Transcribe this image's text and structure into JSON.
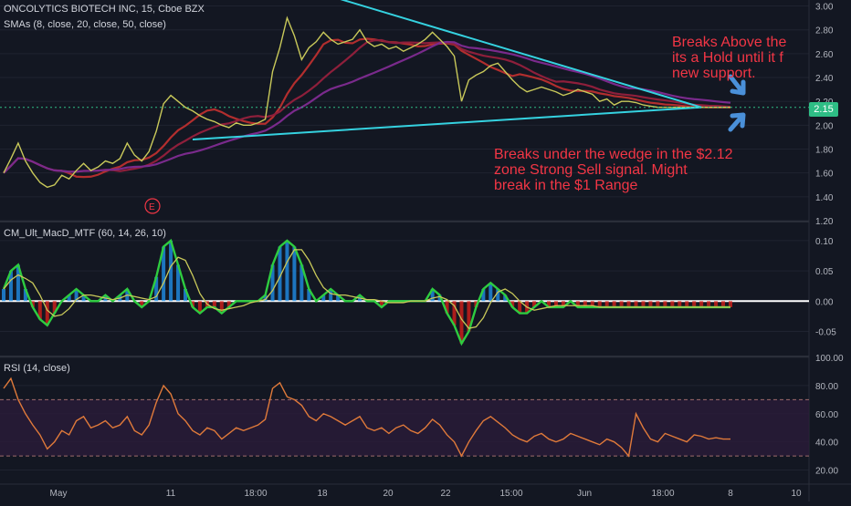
{
  "title": "ONCOLYTICS BIOTECH INC, 15, Cboe BZX",
  "price_pane": {
    "indicator_label": "SMAs (8, close, 20, close, 50, close)",
    "current_price": "2.15",
    "event_marker": "E",
    "annotation_upper": "Breaks Above the\nits a Hold until it f\nnew support.",
    "annotation_lower": "Breaks under the wedge in the $2.12\nzone Strong Sell signal. Might\nbreak in the $1 Range",
    "colors": {
      "price": "#c9c95a",
      "sma_fast": "#b22e2e",
      "sma_mid": "#8e1f3b",
      "sma_slow": "#7a2a8c",
      "wedge": "#35d2e0",
      "annotation": "#f23645",
      "arrow": "#4a90d9"
    }
  },
  "macd_pane": {
    "label": "CM_Ult_MacD_MTF (60, 14, 26, 10)",
    "colors": {
      "macd_up": "#2ecc40",
      "macd_down": "#e0201a",
      "signal": "#c9c95a",
      "hist_up": "#2196f3",
      "hist_down": "#e0201a"
    }
  },
  "rsi_pane": {
    "label": "RSI (14, close)",
    "colors": {
      "rsi": "#e07a3a",
      "band": "#2a1c3a",
      "bounds": "#9e6b6b"
    }
  },
  "x_axis_labels": [
    "May",
    "11",
    "18:00",
    "18",
    "20",
    "22",
    "15:00",
    "Jun",
    "18:00",
    "8",
    "10"
  ],
  "chart_data": [
    {
      "type": "line",
      "title": "ONCOLYTICS BIOTECH INC, 15, Cboe BZX",
      "y_ticks": [
        "3.00",
        "2.80",
        "2.60",
        "2.40",
        "2.20",
        "2.00",
        "1.80",
        "1.60",
        "1.40",
        "1.20"
      ],
      "ylim": [
        1.2,
        3.05
      ],
      "x": [
        0,
        2,
        4,
        6,
        8,
        10,
        12,
        14,
        16,
        18,
        20,
        22,
        24,
        26,
        28,
        30,
        32,
        34,
        36,
        38,
        40,
        42,
        44,
        46,
        48,
        50,
        52,
        54,
        56,
        58,
        60,
        62,
        64,
        66,
        68,
        70,
        72,
        74,
        76,
        78,
        80,
        82,
        84,
        86,
        88,
        90,
        92,
        94,
        96,
        98,
        100,
        102,
        104,
        106,
        108,
        110,
        112,
        114,
        116,
        118,
        120,
        122,
        124,
        126,
        128,
        130,
        132,
        134,
        136,
        138,
        140,
        142,
        144,
        146,
        148,
        150,
        152,
        154,
        156,
        158,
        160,
        162,
        164,
        166,
        168,
        170,
        172,
        174,
        176,
        178,
        180,
        182,
        184,
        186,
        188,
        190,
        192,
        194,
        196,
        198,
        200
      ],
      "series": [
        {
          "values": [
            1.6,
            1.72,
            1.85,
            1.7,
            1.6,
            1.52,
            1.48,
            1.5,
            1.58,
            1.55,
            1.62,
            1.68,
            1.62,
            1.65,
            1.7,
            1.68,
            1.72,
            1.85,
            1.75,
            1.7,
            1.78,
            1.95,
            2.18,
            2.25,
            2.2,
            2.15,
            2.12,
            2.08,
            2.05,
            2.03,
            2.0,
            1.98,
            2.02,
            2.0,
            2.0,
            2.02,
            2.05,
            2.45,
            2.65,
            2.9,
            2.75,
            2.55,
            2.65,
            2.7,
            2.78,
            2.72,
            2.68,
            2.7,
            2.72,
            2.8,
            2.7,
            2.66,
            2.68,
            2.64,
            2.66,
            2.62,
            2.65,
            2.68,
            2.72,
            2.78,
            2.72,
            2.66,
            2.58,
            2.2,
            2.38,
            2.42,
            2.45,
            2.5,
            2.52,
            2.45,
            2.38,
            2.32,
            2.28,
            2.3,
            2.32,
            2.3,
            2.28,
            2.25,
            2.27,
            2.3,
            2.28,
            2.26,
            2.2,
            2.22,
            2.17,
            2.2,
            2.2,
            2.19,
            2.17,
            2.16,
            2.15,
            2.15,
            2.15,
            2.15,
            2.15,
            2.15,
            2.15,
            2.15,
            2.15,
            2.15,
            2.15
          ]
        }
      ],
      "lines": [
        {
          "name": "wedge-upper",
          "x": [
            88,
            192
          ],
          "y": [
            3.1,
            2.15
          ]
        },
        {
          "name": "wedge-lower",
          "x": [
            52,
            192
          ],
          "y": [
            1.88,
            2.15
          ]
        }
      ]
    },
    {
      "type": "line",
      "title": "CM_Ult_MacD_MTF (60, 14, 26, 10)",
      "y_ticks": [
        "0.10",
        "0.05",
        "0.00",
        "-0.05"
      ],
      "ylim": [
        -0.09,
        0.13
      ],
      "x": [
        0,
        2,
        4,
        6,
        8,
        10,
        12,
        14,
        16,
        18,
        20,
        22,
        24,
        26,
        28,
        30,
        32,
        34,
        36,
        38,
        40,
        42,
        44,
        46,
        48,
        50,
        52,
        54,
        56,
        58,
        60,
        62,
        64,
        66,
        68,
        70,
        72,
        74,
        76,
        78,
        80,
        82,
        84,
        86,
        88,
        90,
        92,
        94,
        96,
        98,
        100,
        102,
        104,
        106,
        108,
        110,
        112,
        114,
        116,
        118,
        120,
        122,
        124,
        126,
        128,
        130,
        132,
        134,
        136,
        138,
        140,
        142,
        144,
        146,
        148,
        150,
        152,
        154,
        156,
        158,
        160,
        162,
        164,
        166,
        168,
        170,
        172,
        174,
        176,
        178,
        180,
        182,
        184,
        186,
        188,
        190,
        192,
        194,
        196,
        198,
        200
      ],
      "series": [
        {
          "name": "MACD",
          "values": [
            0.02,
            0.05,
            0.06,
            0.02,
            -0.01,
            -0.03,
            -0.04,
            -0.02,
            0.0,
            0.01,
            0.02,
            0.01,
            0.0,
            0.0,
            0.01,
            0.0,
            0.01,
            0.02,
            0.0,
            -0.01,
            0.0,
            0.04,
            0.09,
            0.1,
            0.06,
            0.02,
            -0.01,
            -0.02,
            -0.01,
            -0.01,
            -0.02,
            -0.01,
            0.0,
            0.0,
            0.0,
            0.0,
            0.01,
            0.06,
            0.09,
            0.1,
            0.09,
            0.06,
            0.02,
            0.0,
            0.01,
            0.02,
            0.01,
            0.0,
            0.0,
            0.01,
            0.0,
            0.0,
            -0.01,
            0.0,
            0.0,
            0.0,
            0.0,
            0.0,
            0.0,
            0.02,
            0.01,
            -0.02,
            -0.04,
            -0.07,
            -0.05,
            -0.01,
            0.02,
            0.03,
            0.02,
            0.01,
            -0.01,
            -0.02,
            -0.02,
            -0.01,
            0.0,
            -0.01,
            -0.01,
            -0.01,
            0.0,
            -0.01,
            -0.01,
            -0.01,
            -0.01,
            -0.01,
            -0.01,
            -0.01,
            -0.01,
            -0.01,
            -0.01,
            -0.01,
            -0.01,
            -0.01,
            -0.01,
            -0.01,
            -0.01,
            -0.01,
            -0.01,
            -0.01,
            -0.01,
            -0.01,
            -0.01
          ]
        }
      ]
    },
    {
      "type": "line",
      "title": "RSI (14, close)",
      "y_ticks": [
        "100.00",
        "80.00",
        "60.00",
        "40.00",
        "20.00"
      ],
      "ylim": [
        10,
        100
      ],
      "bands": [
        30,
        70
      ],
      "x": [
        0,
        2,
        4,
        6,
        8,
        10,
        12,
        14,
        16,
        18,
        20,
        22,
        24,
        26,
        28,
        30,
        32,
        34,
        36,
        38,
        40,
        42,
        44,
        46,
        48,
        50,
        52,
        54,
        56,
        58,
        60,
        62,
        64,
        66,
        68,
        70,
        72,
        74,
        76,
        78,
        80,
        82,
        84,
        86,
        88,
        90,
        92,
        94,
        96,
        98,
        100,
        102,
        104,
        106,
        108,
        110,
        112,
        114,
        116,
        118,
        120,
        122,
        124,
        126,
        128,
        130,
        132,
        134,
        136,
        138,
        140,
        142,
        144,
        146,
        148,
        150,
        152,
        154,
        156,
        158,
        160,
        162,
        164,
        166,
        168,
        170,
        172,
        174,
        176,
        178,
        180,
        182,
        184,
        186,
        188,
        190,
        192,
        194,
        196,
        198,
        200
      ],
      "series": [
        {
          "name": "RSI",
          "values": [
            78,
            85,
            70,
            60,
            52,
            45,
            35,
            40,
            48,
            45,
            55,
            58,
            50,
            52,
            55,
            50,
            52,
            58,
            48,
            45,
            52,
            68,
            80,
            74,
            60,
            55,
            48,
            45,
            50,
            48,
            42,
            46,
            50,
            48,
            50,
            52,
            56,
            78,
            82,
            72,
            70,
            66,
            58,
            55,
            60,
            58,
            55,
            52,
            55,
            58,
            50,
            48,
            50,
            46,
            50,
            52,
            48,
            46,
            50,
            56,
            52,
            45,
            40,
            30,
            40,
            48,
            55,
            58,
            54,
            50,
            45,
            42,
            40,
            44,
            46,
            42,
            40,
            42,
            46,
            44,
            42,
            40,
            38,
            42,
            40,
            36,
            30,
            60,
            50,
            42,
            40,
            46,
            44,
            42,
            40,
            45,
            44,
            42,
            43,
            42,
            42
          ]
        }
      ]
    }
  ]
}
